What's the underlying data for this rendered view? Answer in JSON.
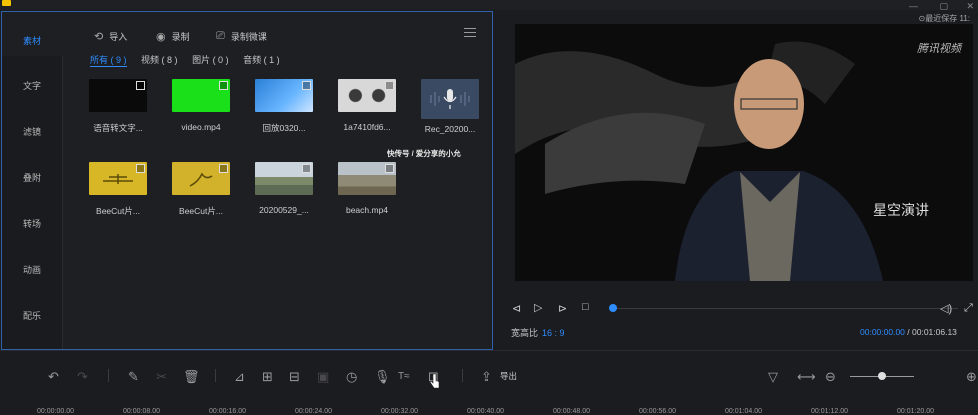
{
  "app": {
    "menu": [
      "",
      "",
      "",
      ""
    ],
    "top_right_status": "⊙最近保存 11:"
  },
  "categories": [
    {
      "label": "素材",
      "active": true
    },
    {
      "label": "文字",
      "active": false
    },
    {
      "label": "滤镜",
      "active": false
    },
    {
      "label": "叠附",
      "active": false
    },
    {
      "label": "转场",
      "active": false
    },
    {
      "label": "动画",
      "active": false
    },
    {
      "label": "配乐",
      "active": false
    }
  ],
  "library_toolbar": {
    "import_label": "导入",
    "record_label": "录制",
    "record_course_label": "录制微课"
  },
  "filters": {
    "all": "所有 ( 9 )",
    "video": "视频 ( 8 )",
    "image": "图片 ( 0 )",
    "audio": "音频 ( 1 )"
  },
  "media": [
    {
      "caption": "语音转文字...",
      "thumb": "black"
    },
    {
      "caption": "video.mp4",
      "thumb": "green"
    },
    {
      "caption": "回放0320...",
      "thumb": "blue"
    },
    {
      "caption": "1a7410fd6...",
      "thumb": "glasses"
    },
    {
      "caption": "Rec_20200...",
      "thumb": "mic"
    },
    {
      "caption": "BeeCut片...",
      "thumb": "yellow1"
    },
    {
      "caption": "BeeCut片...",
      "thumb": "yellow2"
    },
    {
      "caption": "20200529_...",
      "thumb": "land1"
    },
    {
      "caption": "beach.mp4",
      "thumb": "land2"
    }
  ],
  "watermark_text": "快传号 / 爱分享的小允",
  "preview": {
    "logo_text": "腾讯视频",
    "show_title": "星空演讲"
  },
  "playback": {
    "aspect_label": "宽高比",
    "aspect_value": "16 : 9",
    "current_time": "00:00:00.00",
    "total_time": "/ 00:01:06.13",
    "progress": 0
  },
  "editor_toolbar": {
    "export_label": "导出"
  },
  "timeline_ticks": [
    "00:00:00.00",
    "00:00:08.00",
    "00:00:16.00",
    "00:00:24.00",
    "00:00:32.00",
    "00:00:40.00",
    "00:00:48.00",
    "00:00:56.00",
    "00:01:04.00",
    "00:01:12.00",
    "00:01:20.00"
  ],
  "colors": {
    "accent": "#2f8cff",
    "panel_border": "#2f62a8",
    "background": "#1b1c20"
  }
}
